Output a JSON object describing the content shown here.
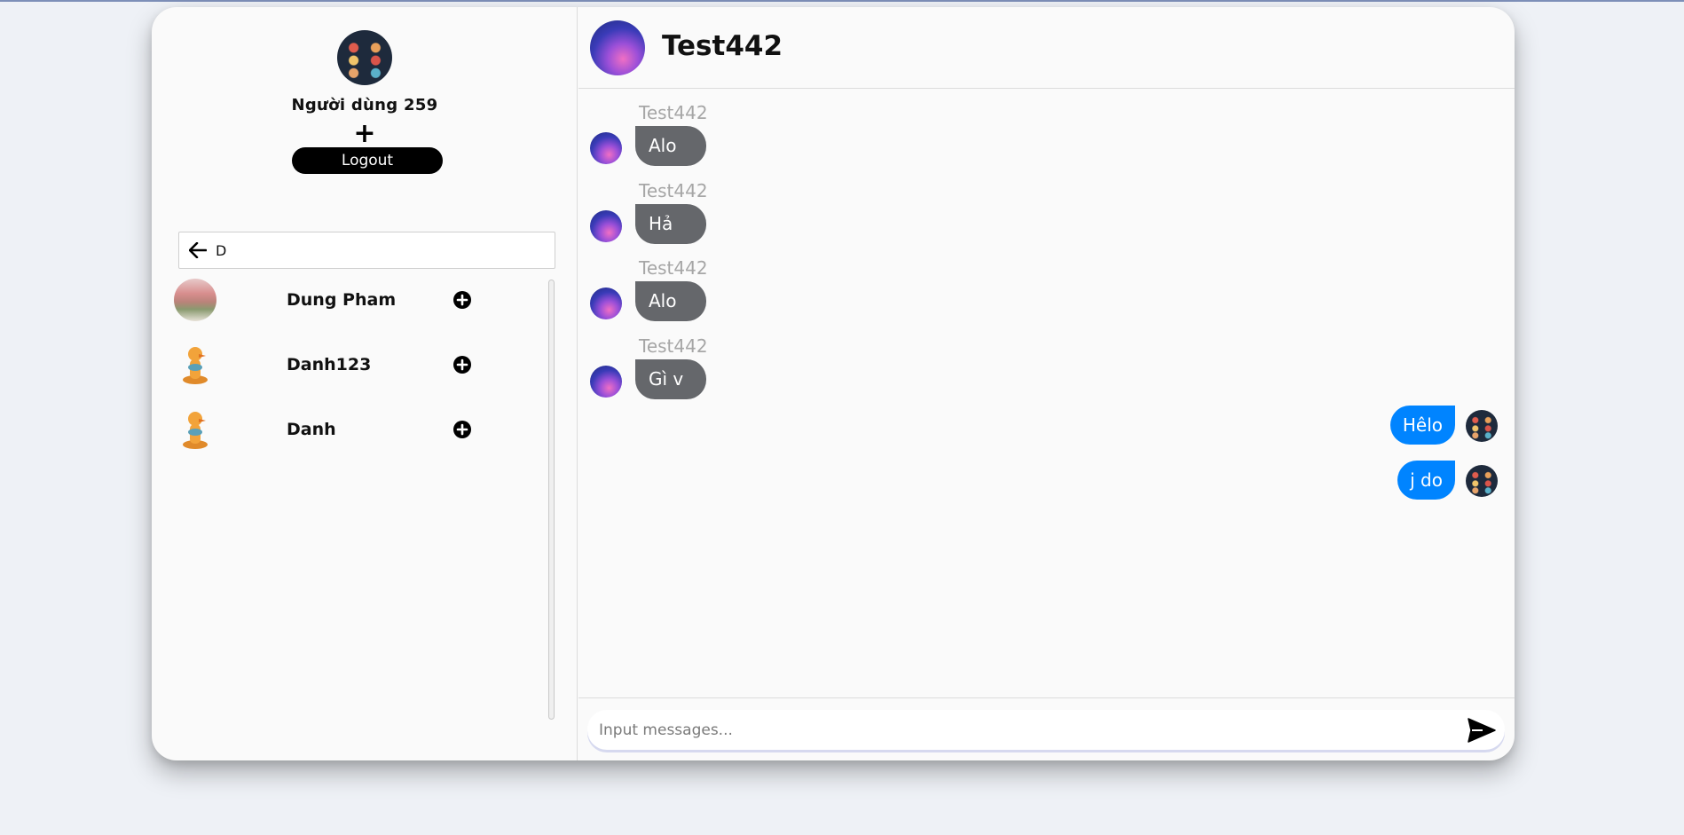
{
  "sidebar": {
    "profile_name": "Người dùng 259",
    "plus_label": "+",
    "logout_label": "Logout",
    "search": {
      "value": "D"
    },
    "results": [
      {
        "name": "Dung Pham"
      },
      {
        "name": "Danh123"
      },
      {
        "name": "Danh"
      }
    ]
  },
  "chat": {
    "contact_name": "Test442",
    "messages_in": [
      {
        "sender": "Test442",
        "text": "Alo"
      },
      {
        "sender": "Test442",
        "text": "Hả"
      },
      {
        "sender": "Test442",
        "text": "Alo"
      },
      {
        "sender": "Test442",
        "text": "Gì v"
      }
    ],
    "messages_out": [
      {
        "text": "Hêlo"
      },
      {
        "text": "j do"
      }
    ],
    "composer": {
      "placeholder": "Input messages..."
    }
  },
  "colors": {
    "incoming_bubble": "#65676b",
    "outgoing_bubble": "#0084ff",
    "logout_bg": "#000000"
  }
}
